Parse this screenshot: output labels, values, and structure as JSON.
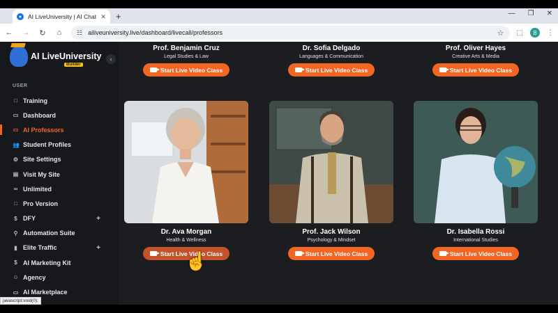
{
  "browser": {
    "tab_title": "AI LiveUniversity | AI Chat",
    "url": "ailiveuniversity.live/dashboard/livecall/professors",
    "profile_initial": "B"
  },
  "brand": {
    "name": "AI LiveUniversity",
    "badge": "Builder"
  },
  "sidebar": {
    "section_label": "USER",
    "items": [
      {
        "label": "Training",
        "icon": "□"
      },
      {
        "label": "Dashboard",
        "icon": "▭"
      },
      {
        "label": "AI Professors",
        "icon": "▭",
        "active": true
      },
      {
        "label": "Student Profiles",
        "icon": "👥"
      },
      {
        "label": "Site Settings",
        "icon": "⚙"
      },
      {
        "label": "Visit My Site",
        "icon": "▤"
      },
      {
        "label": "Unlimited",
        "icon": "∞"
      },
      {
        "label": "Pro Version",
        "icon": "□"
      },
      {
        "label": "DFY",
        "icon": "$",
        "plus": "+"
      },
      {
        "label": "Automation Suite",
        "icon": "⚲"
      },
      {
        "label": "Elite Traffic",
        "icon": "▮",
        "plus": "+"
      },
      {
        "label": "AI Marketing Kit",
        "icon": "$"
      },
      {
        "label": "Agency",
        "icon": "☺"
      },
      {
        "label": "AI Marketplace",
        "icon": "▭"
      }
    ]
  },
  "status_bar": "javascript:void(0);",
  "cta_label": "Start Live Video Class",
  "top_professors": [
    {
      "name": "Prof. Benjamin Cruz",
      "spec": "Legal Studies & Law"
    },
    {
      "name": "Dr. Sofia Delgado",
      "spec": "Languages & Communication"
    },
    {
      "name": "Prof. Oliver Hayes",
      "spec": "Creative Arts & Media"
    }
  ],
  "professors": [
    {
      "name": "Dr. Ava Morgan",
      "spec": "Health & Wellness"
    },
    {
      "name": "Prof. Jack Wilson",
      "spec": "Psychology & Mindset"
    },
    {
      "name": "Dr. Isabella Rossi",
      "spec": "International Studies"
    }
  ],
  "colors": {
    "accent": "#f26522",
    "sidebar_bg": "#16181b",
    "content_bg": "#1b1d21"
  }
}
